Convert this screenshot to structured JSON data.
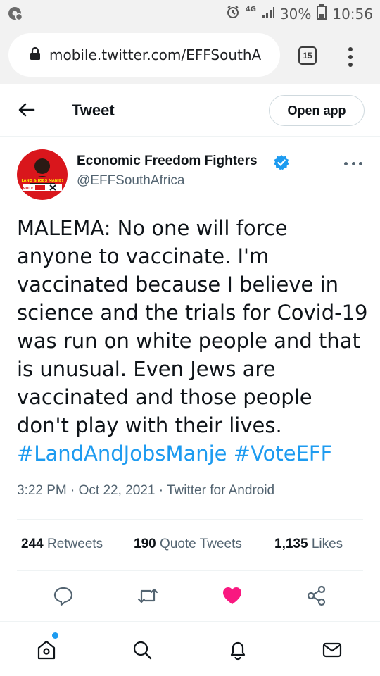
{
  "status_bar": {
    "network": "4G",
    "battery": "30%",
    "time": "10:56"
  },
  "browser": {
    "url": "mobile.twitter.com/EFFSouthA",
    "tab_count": "15"
  },
  "header": {
    "title": "Tweet",
    "open_app_label": "Open app"
  },
  "tweet": {
    "author_name": "Economic Freedom Fighters",
    "author_handle": "@EFFSouthAfrica",
    "avatar_banner": "LAND & JOBS MANJE!",
    "avatar_vote": "VOTE",
    "text": "MALEMA: No one will force anyone to vaccinate. I'm vaccinated because I believe in science and the trials for Covid-19 was run on white people and that is unusual. Even Jews are vaccinated and those people don't play with their lives.",
    "hashtag_1": "#LandAndJobsManje",
    "hashtag_2": "#VoteEFF",
    "time": "3:22 PM",
    "date": "Oct 22, 2021",
    "source": "Twitter for Android",
    "retweets_count": "244",
    "retweets_label": "Retweets",
    "quote_count": "190",
    "quote_label": "Quote Tweets",
    "likes_count": "1,135",
    "likes_label": "Likes"
  },
  "actions": [
    "reply-icon",
    "retweet-icon",
    "like-icon",
    "share-icon"
  ],
  "bottom_nav": [
    "home-icon",
    "search-icon",
    "notifications-icon",
    "messages-icon"
  ],
  "colors": {
    "accent": "#1d9bf0",
    "like": "#f91880",
    "text_primary": "#0f1419",
    "text_secondary": "#536471",
    "avatar_red": "#d9161c"
  }
}
